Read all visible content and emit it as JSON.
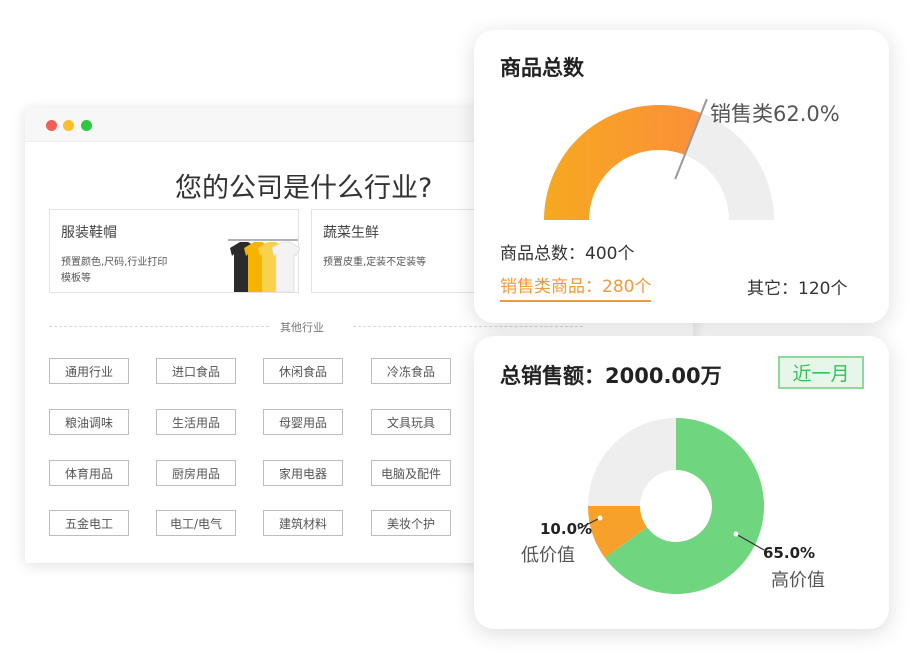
{
  "browser": {
    "window_dots": [
      "#f25f58",
      "#fbbe2f",
      "#30c840"
    ],
    "question": "您的公司是什么行业?",
    "industries": [
      {
        "title": "服装鞋帽",
        "desc": "预置颜色,尺码,行业打印模板等"
      },
      {
        "title": "蔬菜生鲜",
        "desc": "预置皮重,定装不定装等"
      }
    ],
    "other_label": "其他行业",
    "tags": [
      [
        "通用行业",
        "进口食品",
        "休闲食品",
        "冷冻食品"
      ],
      [
        "粮油调味",
        "生活用品",
        "母婴用品",
        "文具玩具"
      ],
      [
        "体育用品",
        "厨房用品",
        "家用电器",
        "电脑及配件"
      ],
      [
        "五金电工",
        "电工/电气",
        "建筑材料",
        "美妆个护"
      ]
    ]
  },
  "goods_card": {
    "title": "商品总数",
    "sales_pct_label": "销售类62.0%",
    "total_line": "商品总数：400个",
    "sales_goods": "销售类商品：280个",
    "others": "其它：120个"
  },
  "sales_card": {
    "title": "总销售额：2000.00万",
    "period": "近一月",
    "low_pct": "10.0%",
    "low_label": "低价值",
    "high_pct": "65.0%",
    "high_label": "高价值"
  },
  "chart_data": [
    {
      "type": "pie",
      "subtype": "half-gauge",
      "slices": [
        {
          "label": "销售类",
          "value": 62.0,
          "color": "#f7a12a"
        },
        {
          "label": "其它",
          "value": 38.0,
          "color": "#eeeeee"
        }
      ]
    },
    {
      "type": "pie",
      "subtype": "donut",
      "slices": [
        {
          "label": "高价值",
          "value": 65.0,
          "color": "#6fd57f"
        },
        {
          "label": "低价值",
          "value": 10.0,
          "color": "#f7a12a"
        },
        {
          "label": "",
          "value": 25.0,
          "color": "#eeeeee"
        }
      ]
    }
  ],
  "colors": {
    "accent_orange": "#f29a3b",
    "green": "#6fd57f",
    "grey": "#eeeeee"
  }
}
